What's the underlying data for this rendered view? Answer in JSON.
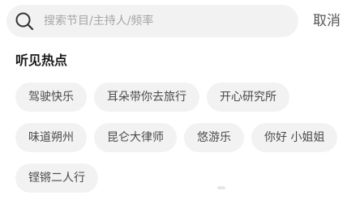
{
  "search": {
    "placeholder": "搜索节目/主持人/频率",
    "icon": "search-icon"
  },
  "cancel_label": "取消",
  "hot_section": {
    "title": "听见热点",
    "rows": [
      [
        "驾驶快乐",
        "耳朵带你去旅行",
        "开心研究所"
      ],
      [
        "味道朔州",
        "昆仑大律师",
        "悠游乐",
        "你好 小姐姐"
      ],
      [
        "铿锵二人行"
      ]
    ]
  },
  "colors": {
    "background": "#ffffff",
    "chip_background": "#f2f2f2",
    "chip_text": "#4a4a4a",
    "placeholder": "#a6a6a6"
  }
}
